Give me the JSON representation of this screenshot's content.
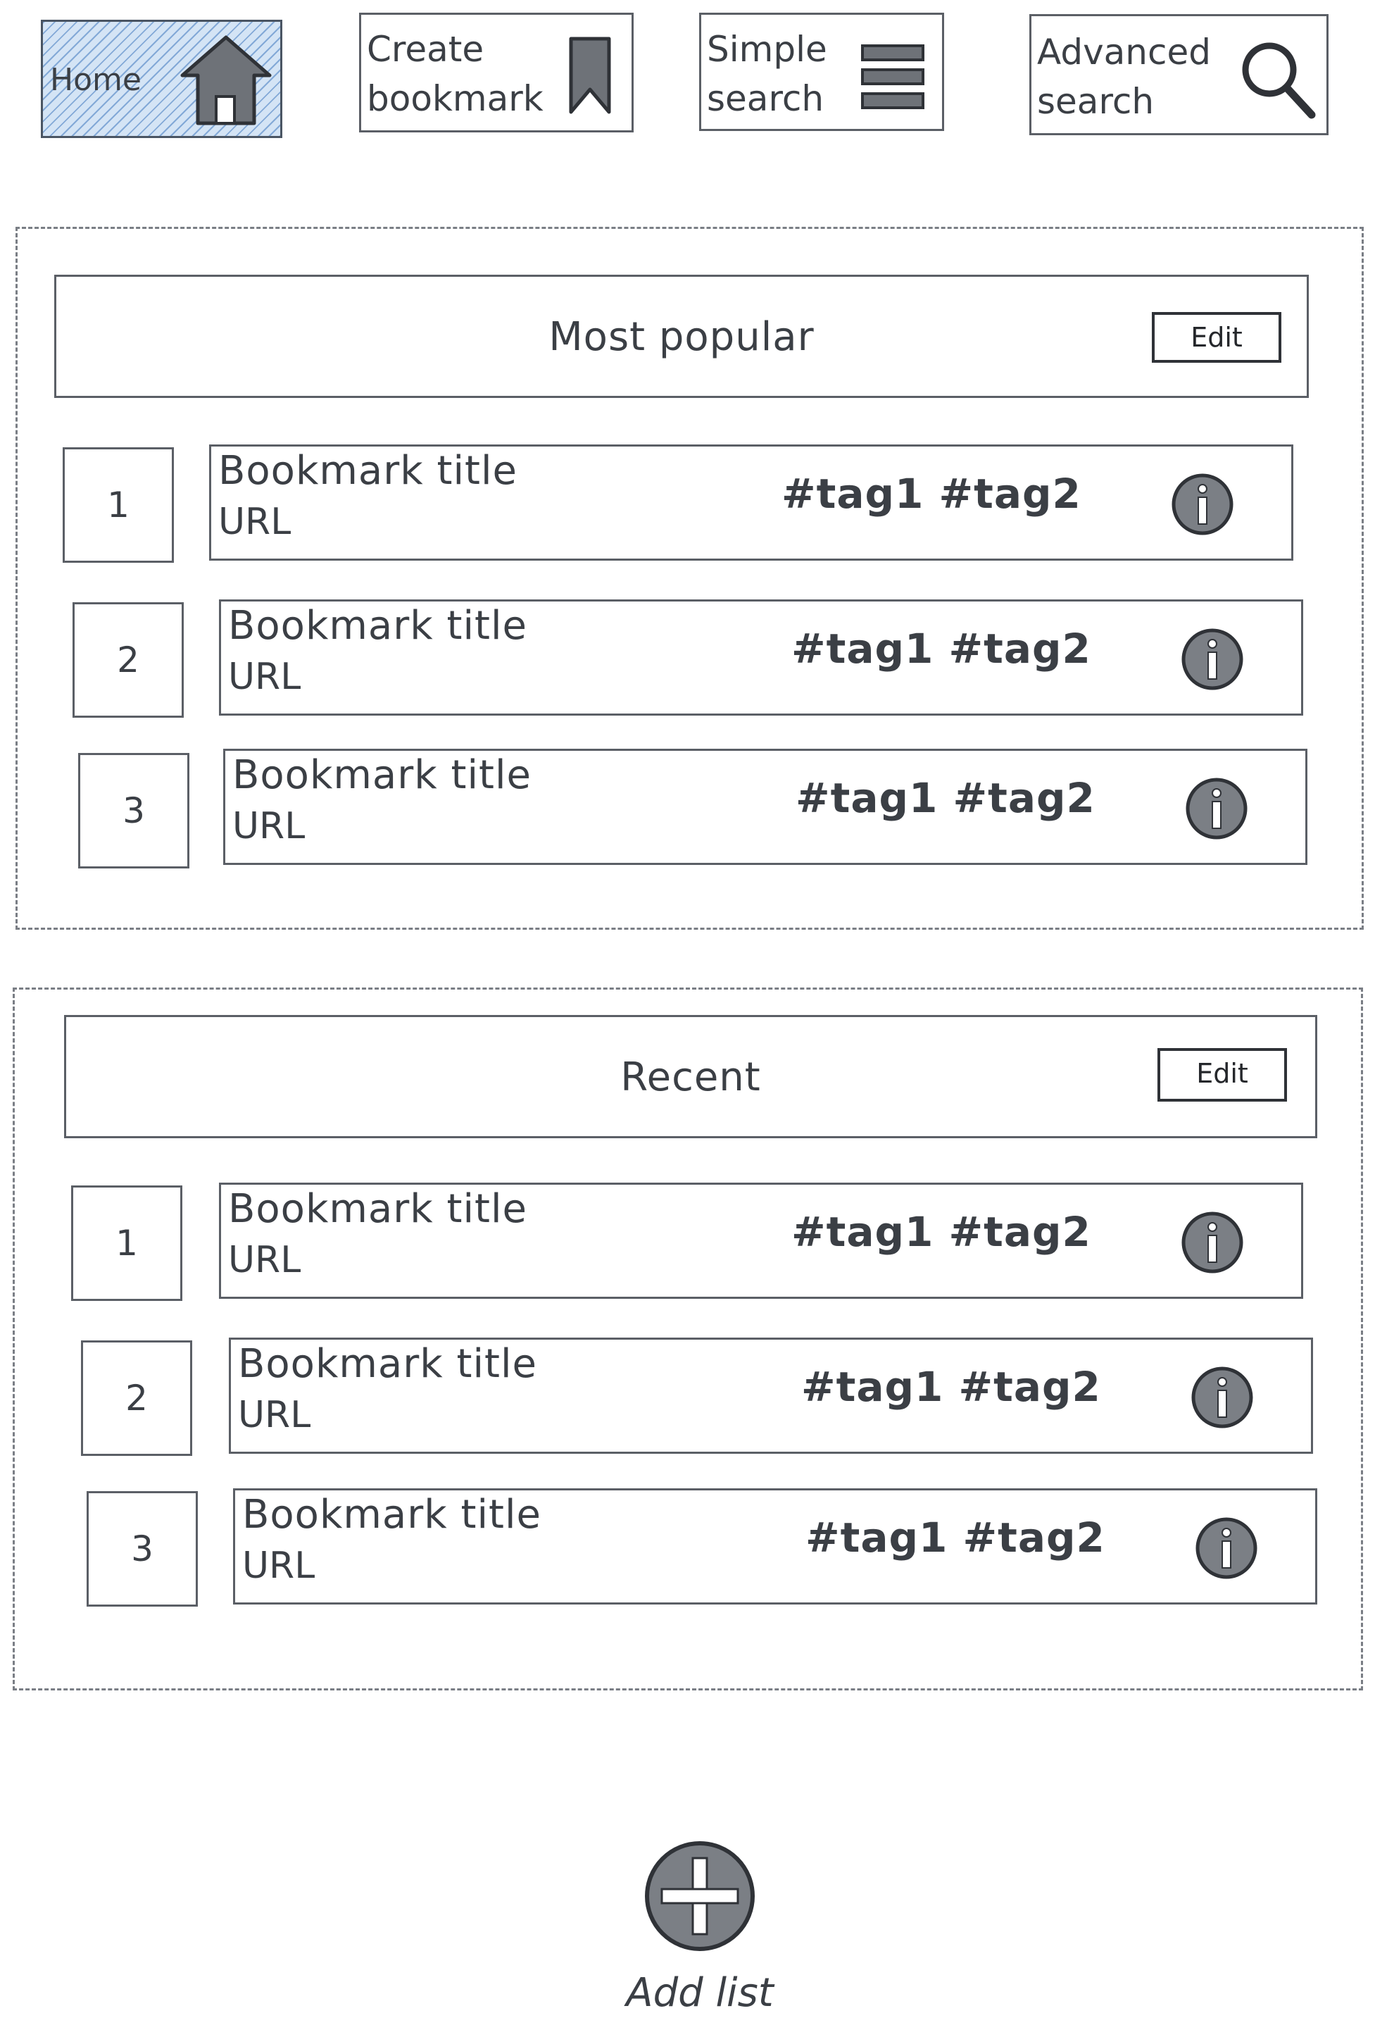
{
  "nav": {
    "home": {
      "label": "Home",
      "icon": "house-icon"
    },
    "create": {
      "label": "Create\nbookmark",
      "icon": "bookmark-icon"
    },
    "simple": {
      "label": "Simple\nsearch",
      "icon": "menu-lines-icon"
    },
    "advanced": {
      "label": "Advanced\nsearch",
      "icon": "magnifier-icon"
    }
  },
  "lists": [
    {
      "title": "Most popular",
      "edit_label": "Edit",
      "items": [
        {
          "rank": "1",
          "title": "Bookmark title",
          "url": "URL",
          "tags": "#tag1 #tag2"
        },
        {
          "rank": "2",
          "title": "Bookmark title",
          "url": "URL",
          "tags": "#tag1 #tag2"
        },
        {
          "rank": "3",
          "title": "Bookmark title",
          "url": "URL",
          "tags": "#tag1 #tag2"
        }
      ]
    },
    {
      "title": "Recent",
      "edit_label": "Edit",
      "items": [
        {
          "rank": "1",
          "title": "Bookmark title",
          "url": "URL",
          "tags": "#tag1 #tag2"
        },
        {
          "rank": "2",
          "title": "Bookmark title",
          "url": "URL",
          "tags": "#tag1 #tag2"
        },
        {
          "rank": "3",
          "title": "Bookmark title",
          "url": "URL",
          "tags": "#tag1 #tag2"
        }
      ]
    }
  ],
  "add_list": {
    "label": "Add list",
    "icon": "plus-circle-icon"
  },
  "colors": {
    "stroke": "#5b5f66",
    "text": "#3b3f45",
    "icon_fill": "#7b7f85",
    "home_fill": "#d4e4f5",
    "home_hatch": "#4078be"
  }
}
